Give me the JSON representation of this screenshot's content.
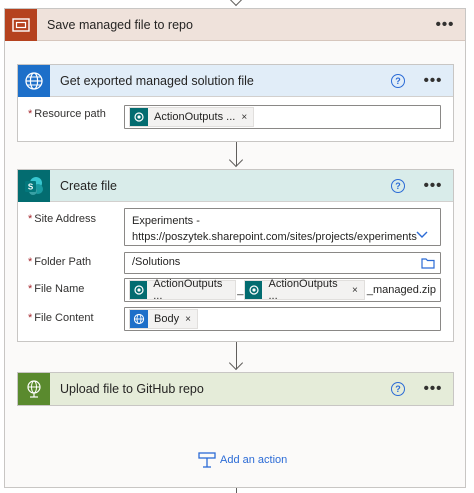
{
  "scope": {
    "title": "Save managed file to repo",
    "more_label": "•••",
    "color": "#b5421f"
  },
  "actions": {
    "get_file": {
      "title": "Get exported managed solution file",
      "icon": "globe-icon",
      "header_color": "#e1edf8",
      "fields": {
        "resource_path": {
          "label": "Resource path",
          "token": "ActionOutputs ...",
          "remove": "×"
        }
      }
    },
    "create_file": {
      "title": "Create file",
      "icon": "sharepoint-icon",
      "header_color": "#d9ecea",
      "fields": {
        "site_address": {
          "label": "Site Address",
          "line1": "Experiments -",
          "line2": "https://poszytek.sharepoint.com/sites/projects/experiments"
        },
        "folder_path": {
          "label": "Folder Path",
          "value": "/Solutions"
        },
        "file_name": {
          "label": "File Name",
          "token1": "ActionOutputs ...",
          "separator": "_",
          "token2": "ActionOutputs ...",
          "suffix": "_managed.zip",
          "remove": "×"
        },
        "file_content": {
          "label": "File Content",
          "token": "Body",
          "remove": "×"
        }
      }
    },
    "upload_file": {
      "title": "Upload file to GitHub repo",
      "icon": "custom-connector-icon",
      "header_color": "#e5ecd9"
    }
  },
  "common": {
    "required_mark": "*",
    "help_label": "?",
    "more_label": "•••"
  },
  "add_action": {
    "label": "Add an action"
  }
}
